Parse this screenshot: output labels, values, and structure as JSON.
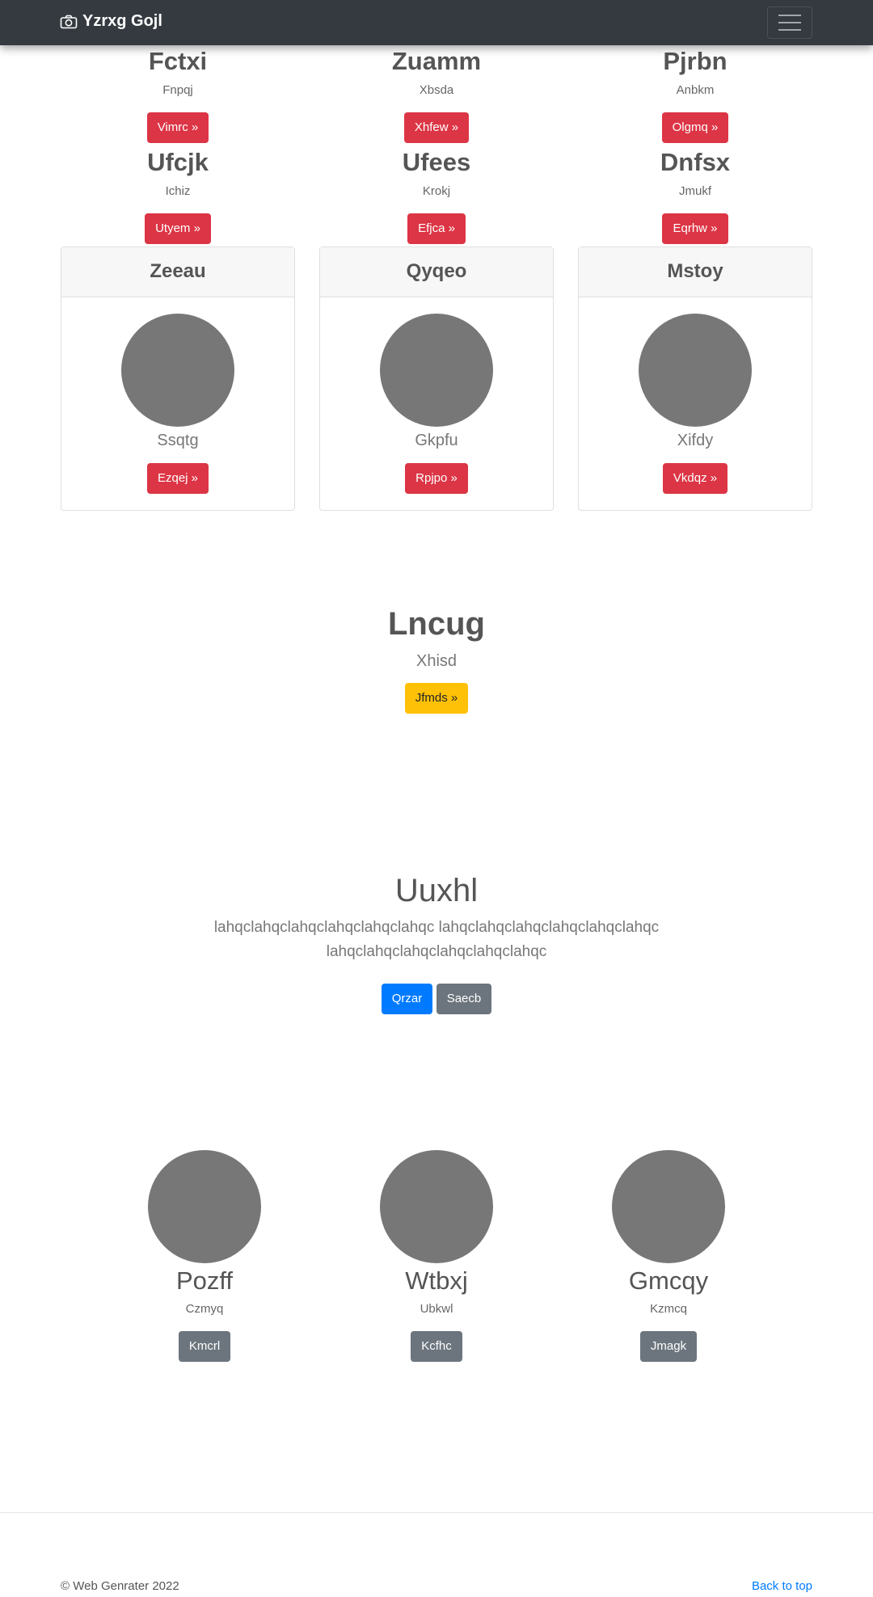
{
  "navbar": {
    "brand": "Yzrxg Gojl",
    "icon": "camera-icon",
    "toggler_icon": "hamburger-icon"
  },
  "top_rows": [
    [
      {
        "title": "Fctxi",
        "subtitle": "Fnpqj",
        "button": "Vimrc »"
      },
      {
        "title": "Zuamm",
        "subtitle": "Xbsda",
        "button": "Xhfew »"
      },
      {
        "title": "Pjrbn",
        "subtitle": "Anbkm",
        "button": "Olgmq »"
      }
    ],
    [
      {
        "title": "Ufcjk",
        "subtitle": "Ichiz",
        "button": "Utyem »"
      },
      {
        "title": "Ufees",
        "subtitle": "Krokj",
        "button": "Efjca »"
      },
      {
        "title": "Dnfsx",
        "subtitle": "Jmukf",
        "button": "Eqrhw »"
      }
    ]
  ],
  "cards": [
    {
      "header": "Zeeau",
      "name": "Ssqtg",
      "button": "Ezqej »"
    },
    {
      "header": "Qyqeo",
      "name": "Gkpfu",
      "button": "Rpjpo »"
    },
    {
      "header": "Mstoy",
      "name": "Xifdy",
      "button": "Vkdqz »"
    }
  ],
  "feature": {
    "title": "Lncug",
    "subtitle": "Xhisd",
    "button": "Jfmds »"
  },
  "hero": {
    "title": "Uuxhl",
    "text_line1": "lahqclahqclahqclahqclahqclahqc lahqclahqclahqclahqclahqclahqc",
    "text_line2": "lahqclahqclahqclahqclahqclahqc",
    "primary_button": "Qrzar",
    "secondary_button": "Saecb"
  },
  "people": [
    {
      "name": "Pozff",
      "sub": "Czmyq",
      "button": "Kmcrl"
    },
    {
      "name": "Wtbxj",
      "sub": "Ubkwl",
      "button": "Kcfhc"
    },
    {
      "name": "Gmcqy",
      "sub": "Kzmcq",
      "button": "Jmagk"
    }
  ],
  "footer": {
    "copyright": "© Web Genrater 2022",
    "back_to_top": "Back to top"
  },
  "colors": {
    "navbar": "#343a40",
    "danger": "#dc3545",
    "warning": "#ffc107",
    "primary": "#007bff",
    "secondary": "#6c757d",
    "placeholder": "#777777",
    "link": "#007bff"
  }
}
